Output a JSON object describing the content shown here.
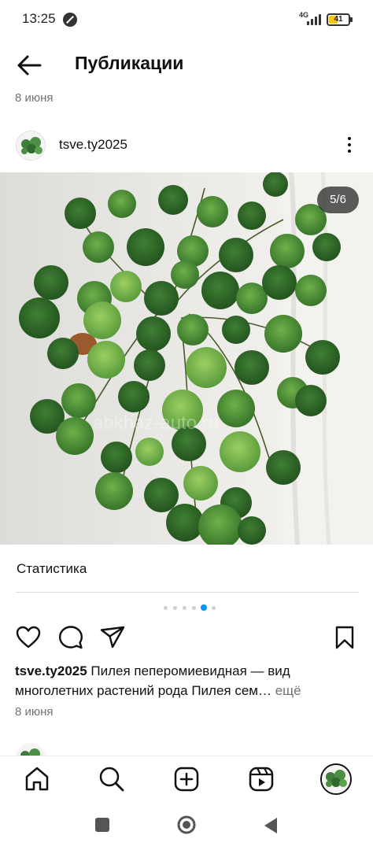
{
  "status_bar": {
    "time": "13:25",
    "network": "4G",
    "battery": "41"
  },
  "header": {
    "title": "Публикации",
    "date": "8 июня"
  },
  "post": {
    "username": "tsve.ty2025",
    "photo_counter": "5/6",
    "watermark": "abkhaz-auto.ru",
    "stats_label": "Статистика",
    "carousel": {
      "total_dots": 6,
      "active_index": 4
    },
    "caption_username": "tsve.ty2025",
    "caption_line1": " Пилея пеперомиевидная — вид",
    "caption_line2": "многолетних растений рода Пилея сем…",
    "caption_more": " ещё",
    "date": "8 июня"
  },
  "icons": {
    "back": "arrow-left-icon",
    "more": "more-vertical-icon",
    "like": "heart-icon",
    "comment": "comment-icon",
    "share": "send-icon",
    "save": "bookmark-icon",
    "nav": [
      "home-icon",
      "search-icon",
      "create-icon",
      "reels-icon",
      "profile-avatar"
    ]
  },
  "colors": {
    "accent": "#0095f6",
    "text": "#111111",
    "muted": "#737373",
    "battery": "#f5c518"
  }
}
